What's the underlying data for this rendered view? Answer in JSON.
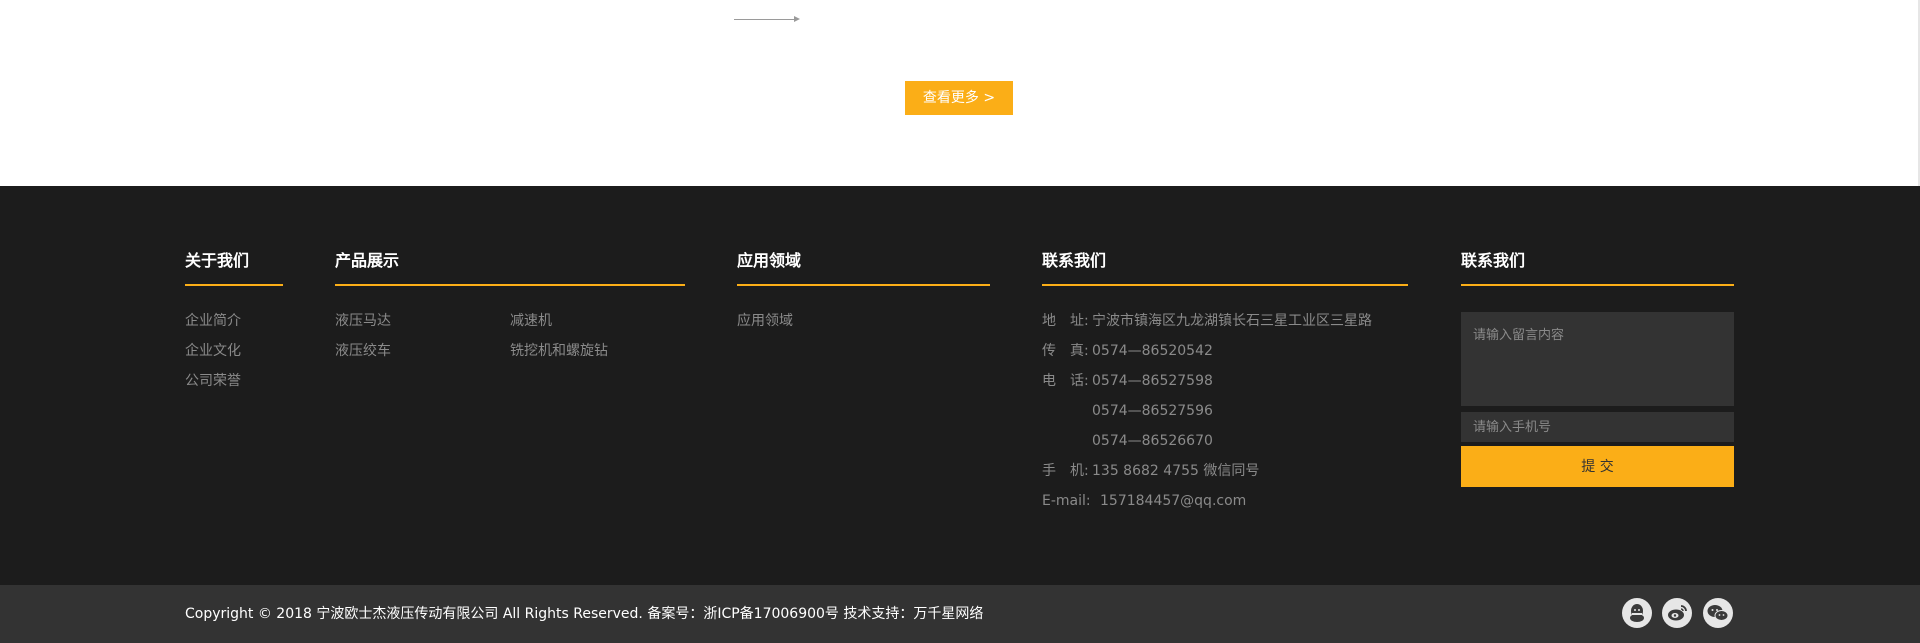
{
  "top": {
    "more_button": "查看更多 >"
  },
  "footer": {
    "about": {
      "title": "关于我们",
      "links": [
        "企业简介",
        "企业文化",
        "公司荣誉"
      ]
    },
    "products": {
      "title": "产品展示",
      "links": [
        "液压马达",
        "减速机",
        "液压绞车",
        "铣挖机和螺旋钻"
      ]
    },
    "applications": {
      "title": "应用领域",
      "links": [
        "应用领域"
      ]
    },
    "contact": {
      "title": "联系我们",
      "address_label": "地　址:",
      "address": "宁波市镇海区九龙湖镇长石三星工业区三星路",
      "fax_label": "传　真:",
      "fax": "0574—86520542",
      "phone_label": "电　话:",
      "phone1": "0574—86527598",
      "phone2": "0574—86527596",
      "phone3": "0574—86526670",
      "mobile_label": "手　机:",
      "mobile": "135 8682 4755 微信同号",
      "email_label": "E-mail:",
      "email": "157184457@qq.com"
    },
    "form": {
      "title": "联系我们",
      "message_placeholder": "请输入留言内容",
      "phone_placeholder": "请输入手机号",
      "submit_label": "提 交"
    }
  },
  "bottom": {
    "copyright": "Copyright © 2018 宁波欧士杰液压传动有限公司 All Rights Reserved. 备案号：浙ICP备17006900号  技术支持：万千星网络",
    "icons": [
      "qq-icon",
      "weibo-icon",
      "wechat-icon"
    ]
  },
  "colors": {
    "accent": "#fbae17",
    "footer_bg": "#1c1c1c",
    "bottom_bg": "#333333"
  }
}
